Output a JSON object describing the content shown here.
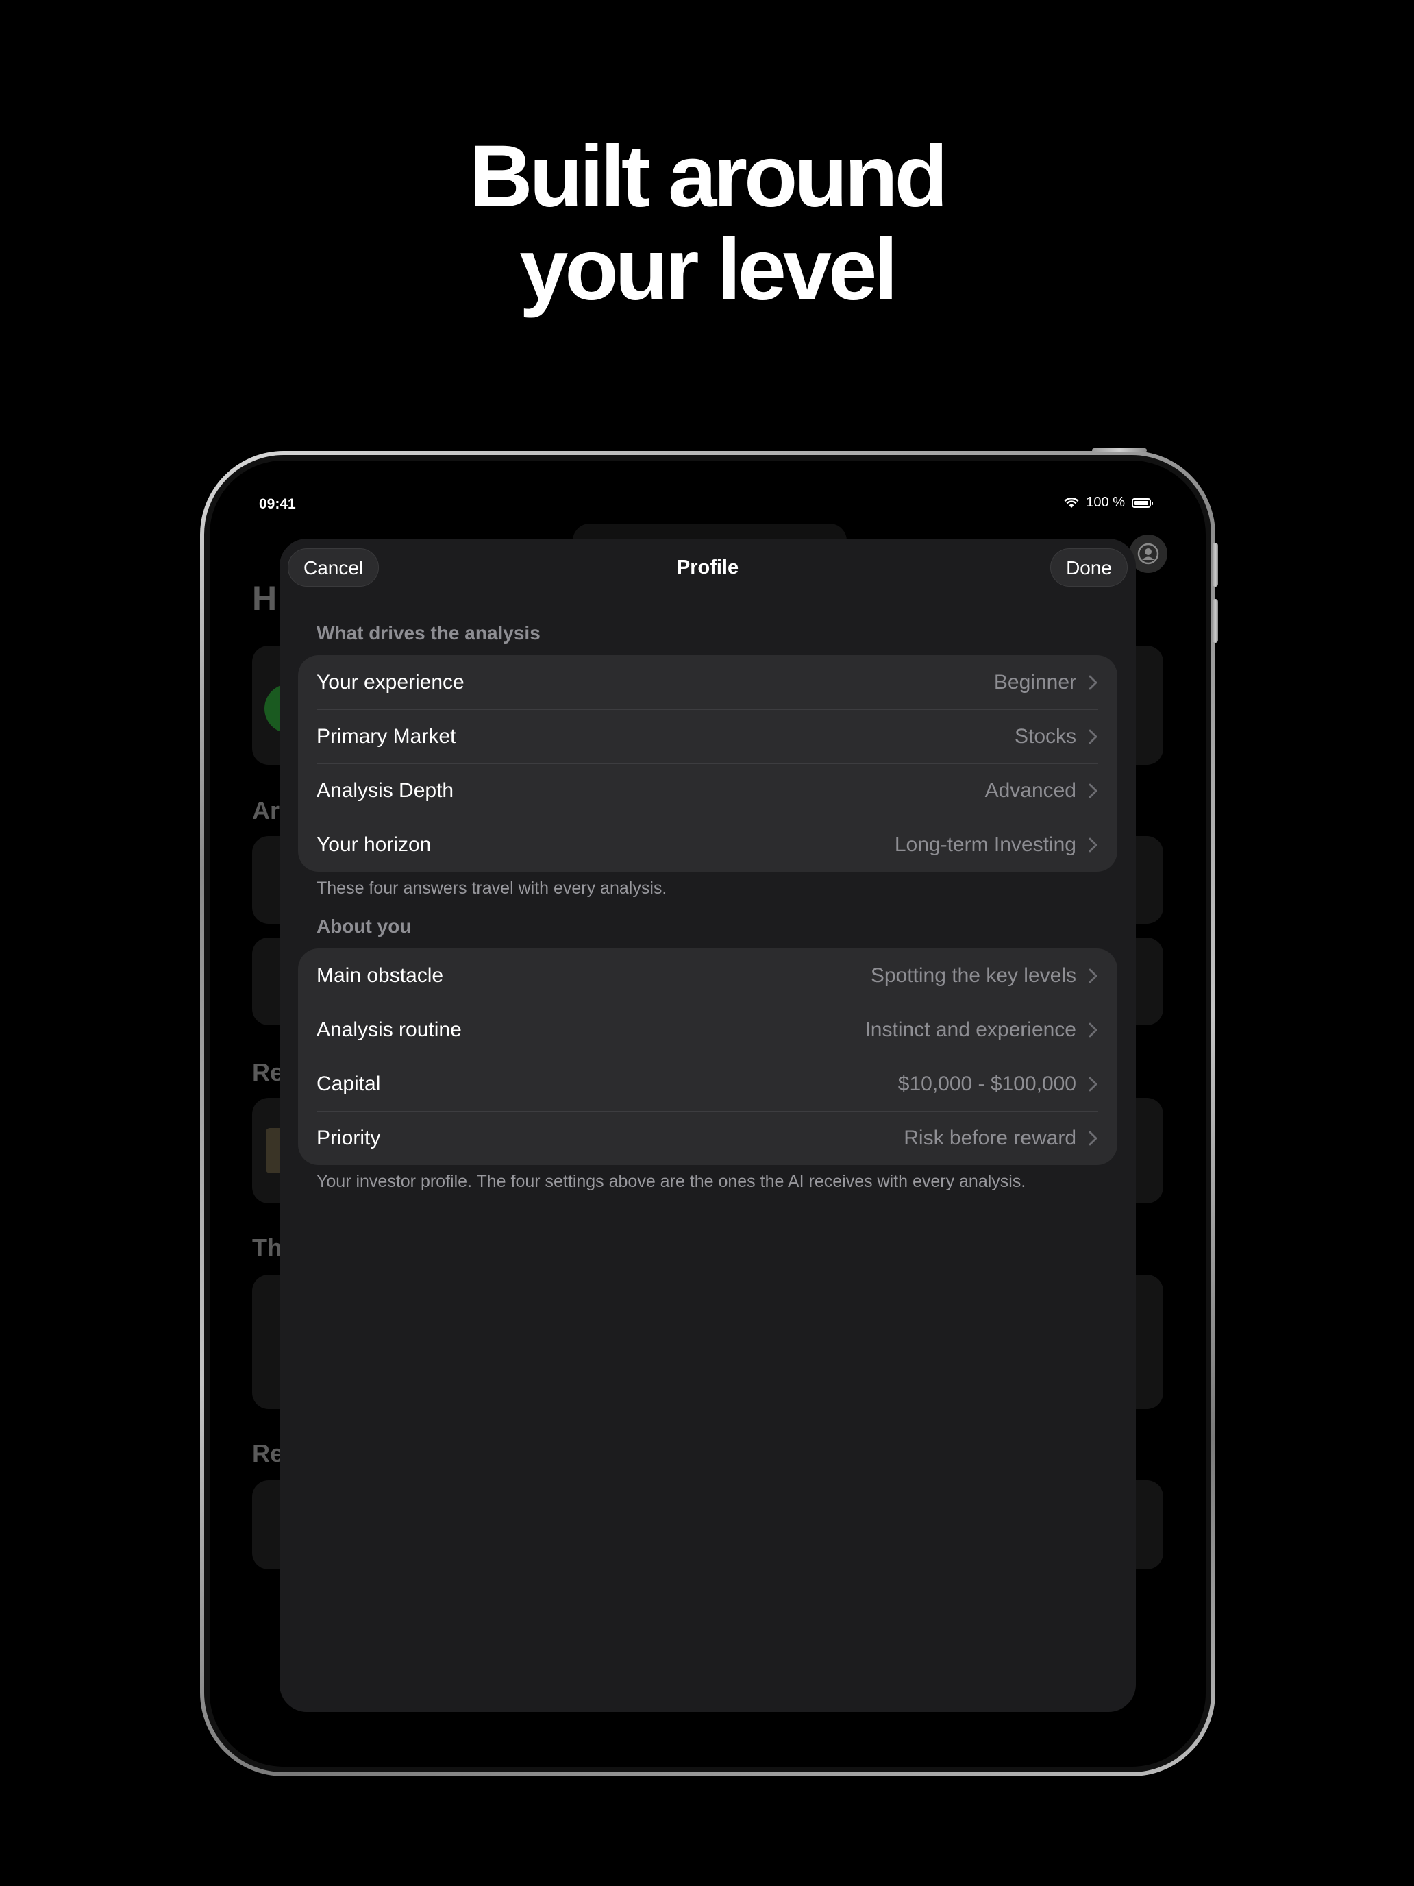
{
  "headline": {
    "line1": "Built around",
    "line2": "your level"
  },
  "status_bar": {
    "time": "09:41",
    "battery": "100 %"
  },
  "sheet": {
    "cancel_label": "Cancel",
    "title": "Profile",
    "done_label": "Done",
    "section1": {
      "header": "What drives the analysis",
      "rows": [
        {
          "label": "Your experience",
          "value": "Beginner"
        },
        {
          "label": "Primary Market",
          "value": "Stocks"
        },
        {
          "label": "Analysis Depth",
          "value": "Advanced"
        },
        {
          "label": "Your horizon",
          "value": "Long-term Investing"
        }
      ],
      "footer": "These four answers travel with every analysis."
    },
    "section2": {
      "header": "About you",
      "rows": [
        {
          "label": "Main obstacle",
          "value": "Spotting the key levels"
        },
        {
          "label": "Analysis routine",
          "value": "Instinct and experience"
        },
        {
          "label": "Capital",
          "value": "$10,000 - $100,000"
        },
        {
          "label": "Priority",
          "value": "Risk before reward"
        }
      ],
      "footer": "Your investor profile. The four settings above are the ones the AI receives with every analysis."
    }
  },
  "colors": {
    "background": "#000000",
    "sheet": "#1c1c1e",
    "group": "#2c2c2e",
    "secondary_text": "#8e8e93"
  },
  "icons": [
    "wifi-icon",
    "battery-icon",
    "profile-avatar-icon",
    "chevron-right-icon"
  ]
}
